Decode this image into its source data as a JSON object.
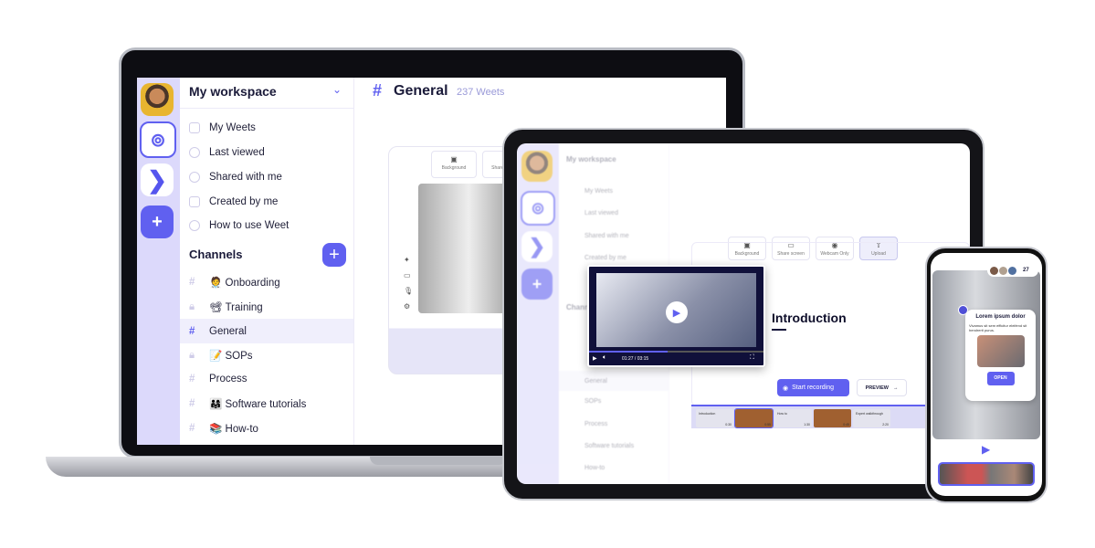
{
  "laptop": {
    "workspace": "My workspace",
    "nav": [
      {
        "label": "My Weets",
        "icon": "video-icon"
      },
      {
        "label": "Last viewed",
        "icon": "clock-icon"
      },
      {
        "label": "Shared with me",
        "icon": "at-icon"
      },
      {
        "label": "Created by me",
        "icon": "user-card-icon"
      },
      {
        "label": "How to use Weet",
        "icon": "help-icon"
      }
    ],
    "channels_title": "Channels",
    "channels": [
      {
        "label": "🧑‍⚕️ Onboarding",
        "icon": "hash-icon"
      },
      {
        "label": "📽 Training",
        "icon": "lock-icon"
      },
      {
        "label": "General",
        "icon": "hash-icon",
        "active": true
      },
      {
        "label": "📝 SOPs",
        "icon": "lock-icon"
      },
      {
        "label": "Process",
        "icon": "hash-icon"
      },
      {
        "label": "👨‍👩‍👧 Software tutorials",
        "icon": "hash-icon"
      },
      {
        "label": "📚 How-to",
        "icon": "hash-icon"
      }
    ],
    "channel_title": "General",
    "weet_count": "237 Weets",
    "toolbar": [
      "Background",
      "Share screen"
    ]
  },
  "tablet": {
    "workspace": "My workspace",
    "nav": [
      "My Weets",
      "Last viewed",
      "Shared with me",
      "Created by me"
    ],
    "channels_title": "Channels",
    "channels": [
      "General",
      "SOPs",
      "Process",
      "Software tutorials",
      "How-to"
    ],
    "toolbar": [
      "Background",
      "Share screen",
      "Webcam Only",
      "Upload"
    ],
    "heading": "Introduction",
    "video": {
      "current": "01:27",
      "duration": "03:15",
      "progress": 0.45
    },
    "start_recording": "Start recording",
    "preview": "PREVIEW",
    "filmstrip": [
      {
        "title": "Introduction",
        "time": "0:30"
      },
      {
        "title": "",
        "time": "0:55"
      },
      {
        "title": "How to",
        "time": "1:30"
      },
      {
        "title": "",
        "time": "0:45"
      },
      {
        "title": "Expert walkthrough",
        "time": "2:20"
      }
    ]
  },
  "phone": {
    "viewer_count": "27",
    "card_title": "Lorem ipsum dolor",
    "card_text": "Vivamus sit sem efficitur eleifend sit hendrerit purus.",
    "open": "OPEN"
  },
  "colors": {
    "accent": "#6060f0",
    "rail": "#dcd9fb",
    "dark": "#14143a"
  }
}
